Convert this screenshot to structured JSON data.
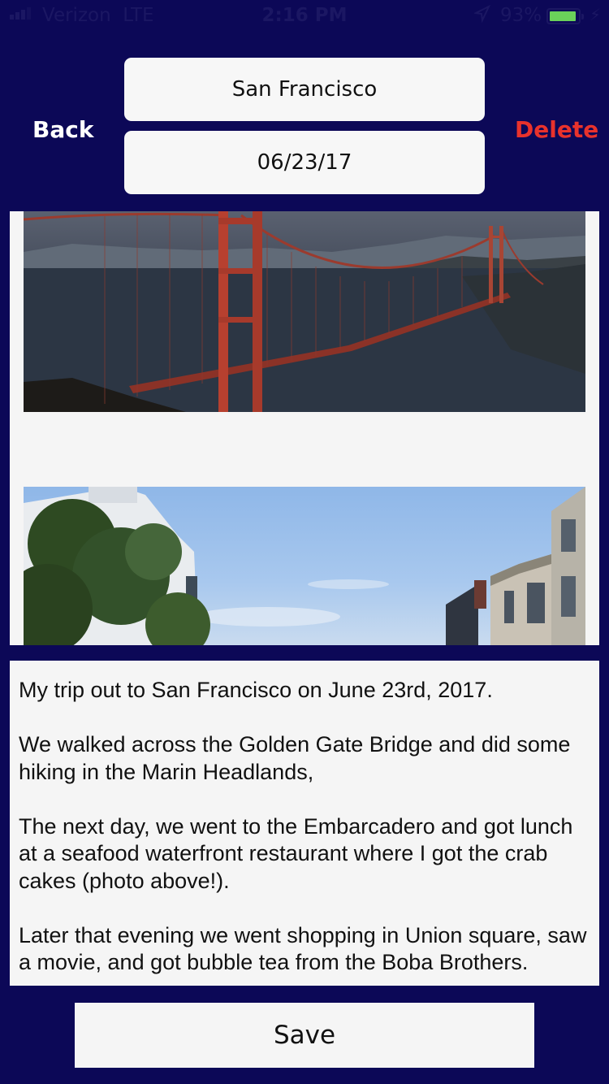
{
  "status_bar": {
    "carrier": "Verizon",
    "network": "LTE",
    "time": "2:16 PM",
    "battery_pct": "93%",
    "battery_level": 0.93,
    "battery_color": "#6ad15a",
    "icons": [
      "signal-icon",
      "location-arrow-icon",
      "battery-icon",
      "charging-bolt-icon"
    ]
  },
  "nav": {
    "back_label": "Back",
    "delete_label": "Delete",
    "delete_color": "#e8322c"
  },
  "entry": {
    "title": "San Francisco",
    "date": "06/23/17"
  },
  "photos": [
    {
      "subject": "golden-gate-bridge"
    },
    {
      "subject": "street-houses-blue-sky"
    }
  ],
  "notes": {
    "paragraphs": [
      "My trip out to San Francisco on June 23rd, 2017.",
      "We walked across the Golden Gate Bridge and did some hiking in the Marin Headlands,",
      "The next day, we went to the Embarcadero and got lunch at a seafood waterfront restaurant where I got the crab cakes (photo above!).",
      "Later that evening we went shopping in Union square, saw a movie, and got bubble tea from the Boba Brothers."
    ]
  },
  "save_label": "Save",
  "colors": {
    "background": "#0c0857",
    "panel": "#f5f5f5"
  }
}
